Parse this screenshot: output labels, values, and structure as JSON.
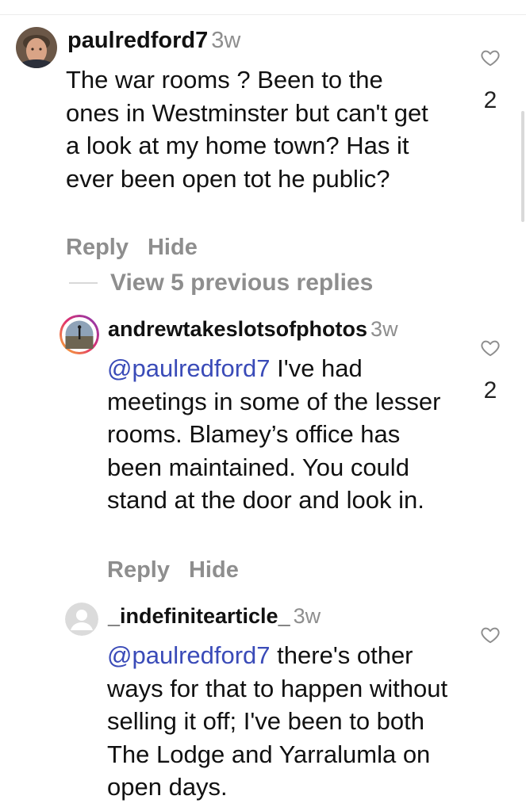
{
  "comments": [
    {
      "username": "paulredford7",
      "time": "3w",
      "text": "The war rooms ? Been to the ones in Westminster but can't get a look at my home town? Has it ever been open tot he public?",
      "reply_label": "Reply",
      "hide_label": "Hide",
      "like_count": "2"
    },
    {
      "username": "andrewtakeslotsofphotos",
      "time": "3w",
      "mention": "@paulredford7",
      "text": " I've had meetings in some of the lesser rooms. Blamey’s office has been maintained. You could stand at the door and look in.",
      "reply_label": "Reply",
      "hide_label": "Hide",
      "like_count": "2"
    },
    {
      "username": "_indefinitearticle_",
      "time": "3w",
      "mention": "@paulredford7",
      "text": " there's other ways for that to happen without selling it off; I've been to both The Lodge and Yarralumla on open days."
    }
  ],
  "view_previous": "View 5 previous replies",
  "colors": {
    "mention": "#3a4bb8",
    "secondary": "#8e8e8e",
    "ring": "#e1306c"
  },
  "icons": [
    "heart-outline-icon",
    "avatar-photo",
    "default-avatar-icon"
  ]
}
